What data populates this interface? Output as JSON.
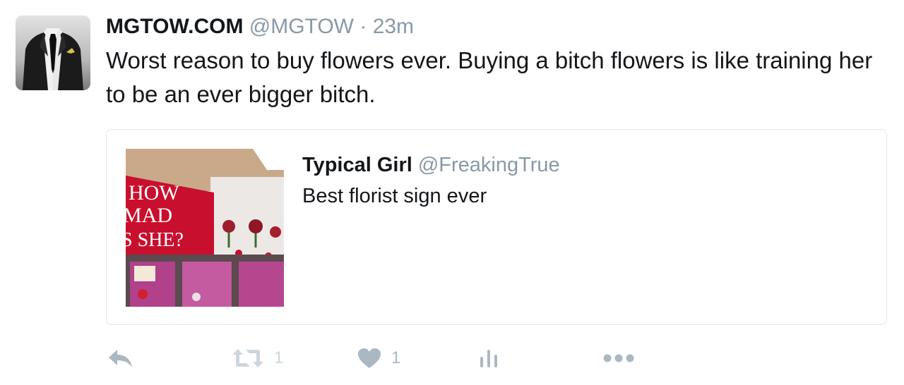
{
  "tweet": {
    "author_name": "MGTOW.COM",
    "author_handle": "@MGTOW",
    "separator": "·",
    "time": "23m",
    "text": "Worst reason to buy flowers ever. Buying a bitch flowers is like training her to be an ever bigger bitch."
  },
  "quoted_tweet": {
    "author_name": "Typical Girl",
    "author_handle": "@FreakingTrue",
    "text": "Best florist sign ever",
    "image_sign_text": [
      "HOW",
      "MAD",
      "S SHE?"
    ]
  },
  "actions": {
    "retweet_count": "1",
    "like_count": "1"
  },
  "colors": {
    "text": "#14171a",
    "secondary": "#8899a6",
    "icon": "#aab8c2",
    "border": "#e1e8ed",
    "sign_red": "#c8102e"
  },
  "icons": [
    "reply-icon",
    "retweet-icon",
    "heart-icon",
    "analytics-icon",
    "more-icon"
  ]
}
